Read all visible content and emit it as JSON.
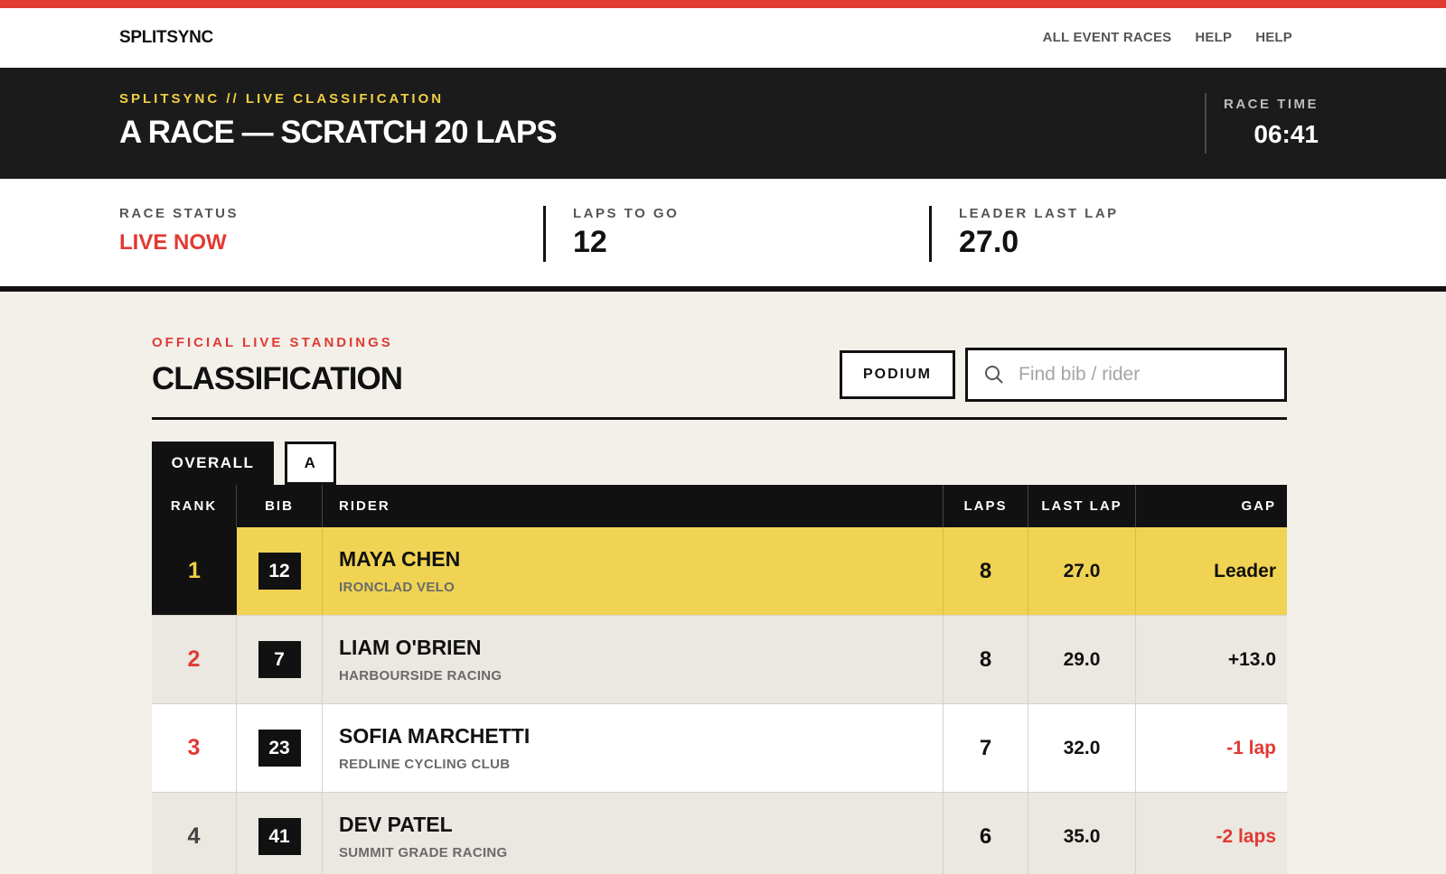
{
  "nav": {
    "brand": "SPLITSYNC",
    "links": [
      "ALL EVENT RACES",
      "HELP",
      "HELP"
    ]
  },
  "hero": {
    "kicker": "SPLITSYNC // LIVE CLASSIFICATION",
    "title": "A RACE — SCRATCH 20 LAPS",
    "race_time_label": "RACE TIME",
    "race_time": "06:41"
  },
  "stats": {
    "status_label": "RACE STATUS",
    "status_value": "LIVE NOW",
    "laps_label": "LAPS TO GO",
    "laps_value": "12",
    "last_lap_label": "LEADER LAST LAP",
    "last_lap_value": "27.0"
  },
  "section": {
    "kicker": "OFFICIAL LIVE STANDINGS",
    "title": "CLASSIFICATION",
    "podium_label": "PODIUM",
    "search_placeholder": "Find bib / rider"
  },
  "tabs": {
    "overall": "OVERALL",
    "a": "A"
  },
  "table": {
    "headers": {
      "rank": "RANK",
      "bib": "BIB",
      "rider": "RIDER",
      "laps": "LAPS",
      "last_lap": "LAST LAP",
      "gap": "GAP"
    },
    "rows": [
      {
        "rank": "1",
        "bib": "12",
        "name": "MAYA CHEN",
        "team": "IRONCLAD VELO",
        "laps": "8",
        "last_lap": "27.0",
        "gap": "Leader"
      },
      {
        "rank": "2",
        "bib": "7",
        "name": "LIAM O'BRIEN",
        "team": "HARBOURSIDE RACING",
        "laps": "8",
        "last_lap": "29.0",
        "gap": "+13.0"
      },
      {
        "rank": "3",
        "bib": "23",
        "name": "SOFIA MARCHETTI",
        "team": "REDLINE CYCLING CLUB",
        "laps": "7",
        "last_lap": "32.0",
        "gap": "-1 lap"
      },
      {
        "rank": "4",
        "bib": "41",
        "name": "DEV PATEL",
        "team": "SUMMIT GRADE RACING",
        "laps": "6",
        "last_lap": "35.0",
        "gap": "-2 laps"
      }
    ]
  },
  "colors": {
    "accent_red": "#e03a33",
    "accent_yellow": "#f0cf45",
    "leader_row": "#f0d352",
    "dark": "#111111"
  }
}
